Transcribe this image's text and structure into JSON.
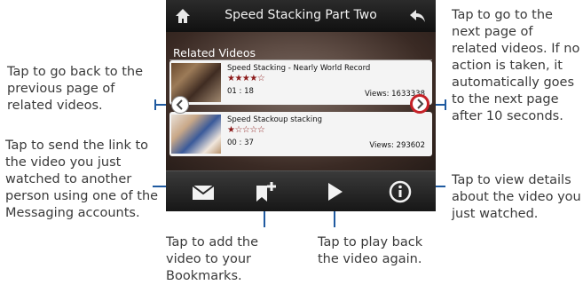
{
  "app": {
    "title": "Speed Stacking Part Two",
    "section_label": "Related Videos",
    "colors": {
      "accent_red": "#c52228",
      "star_red": "#8c1a1a",
      "callout_line": "#1f5aa0"
    }
  },
  "videos": [
    {
      "title": "Speed Stacking  - Nearly World Record",
      "rating": "★★★★☆",
      "duration": "01 : 18",
      "views": "Views: 1633338"
    },
    {
      "title": "Speed Stackoup stacking",
      "rating": "★☆☆☆☆",
      "duration": "00 : 37",
      "views": "Views: 293602"
    }
  ],
  "icons": {
    "home": "home-icon",
    "back": "back-arrow-icon",
    "prev": "chevron-left-icon",
    "next": "chevron-right-icon",
    "mail": "envelope-icon",
    "bookmark": "bookmark-add-icon",
    "play": "play-icon",
    "info": "info-icon"
  },
  "callouts": {
    "prev_page": "Tap to go back to the previous page of related videos.",
    "send_link": "Tap to send the link to the video you just watched to another person using one of the Messaging accounts.",
    "next_page": "Tap to go to the next page of related videos. If no action is taken, it automatically goes to the next page after 10 seconds.",
    "details": "Tap to view details about the video you just watched.",
    "bookmark": "Tap to add the video to your Bookmarks.",
    "play": "Tap to play back the video again."
  }
}
